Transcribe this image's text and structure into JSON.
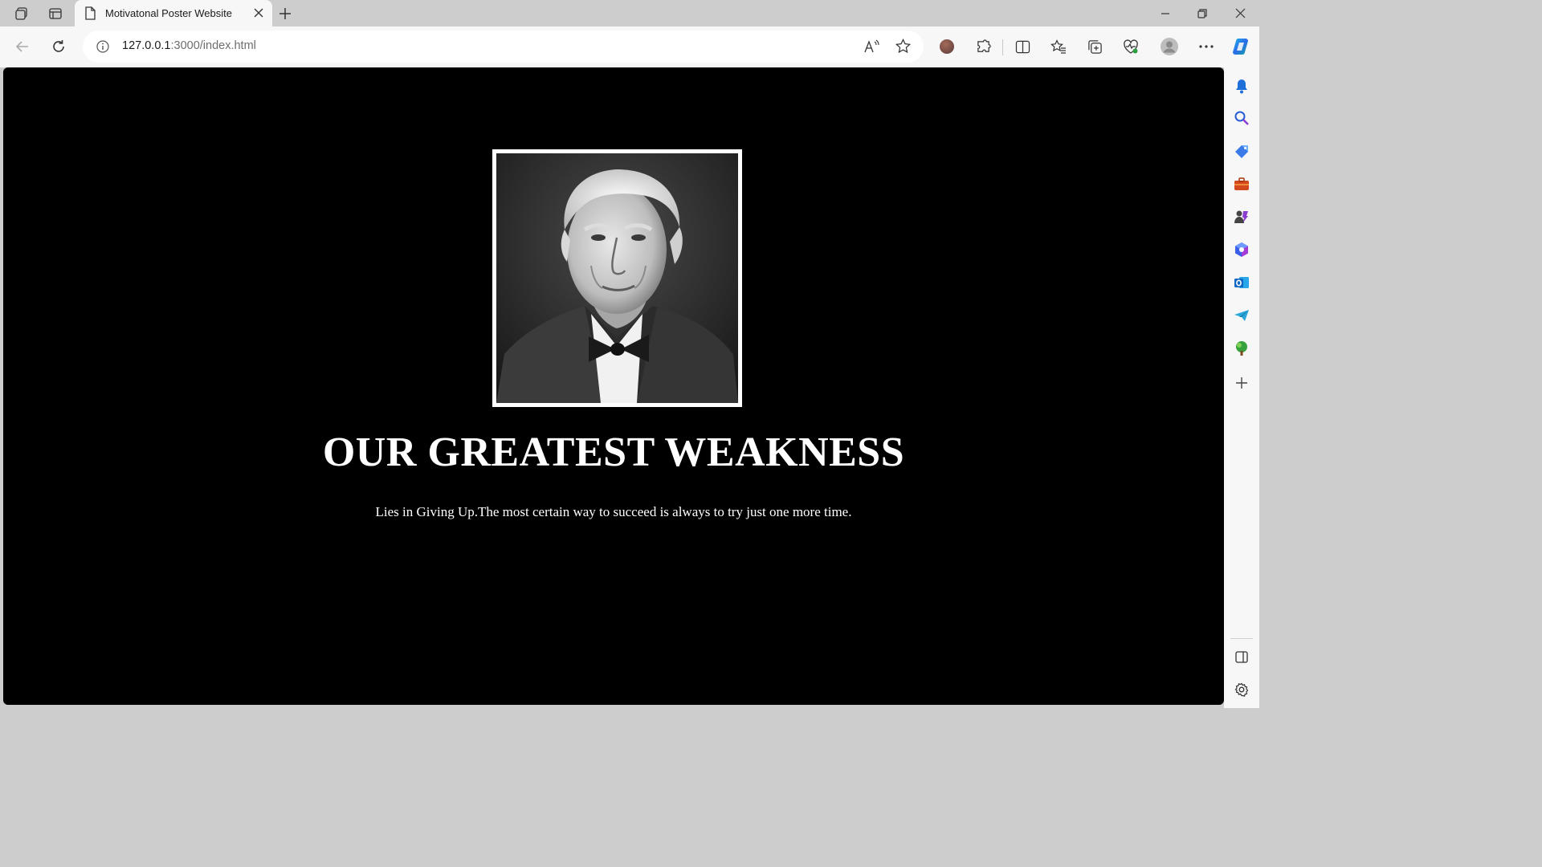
{
  "browser": {
    "tab": {
      "title": "Motivatonal Poster Website",
      "icon": "document-icon"
    },
    "address": {
      "host": "127.0.0.1",
      "rest": ":3000/index.html"
    },
    "toolbar_icons": [
      "back-icon",
      "refresh-icon",
      "info-icon",
      "read-aloud-icon",
      "favorite-star-icon",
      "profile-extension-icon",
      "extensions-icon",
      "split-screen-icon",
      "favorites-icon",
      "collections-icon",
      "browser-essentials-icon",
      "profile-icon",
      "more-icon",
      "copilot-icon"
    ],
    "sidebar_icons": [
      "notifications-icon",
      "search-icon",
      "shopping-icon",
      "tools-icon",
      "games-icon",
      "microsoft365-icon",
      "outlook-icon",
      "drop-icon",
      "tree-icon",
      "add-icon"
    ]
  },
  "poster": {
    "image_alt": "portrait",
    "title": "OUR GREATEST WEAKNESS",
    "subtitle": "Lies in Giving Up.The most certain way to succeed is always to try just one more time."
  },
  "colors": {
    "page_background": "#000000",
    "text": "#ffffff",
    "frame": "#ffffff",
    "chrome": "#cdcdcd"
  }
}
